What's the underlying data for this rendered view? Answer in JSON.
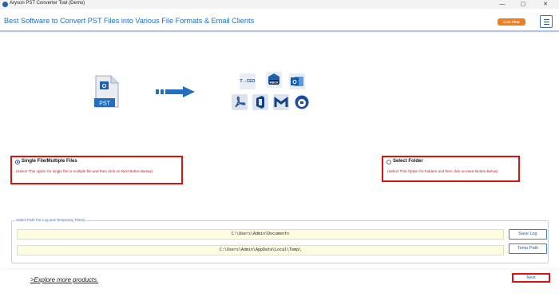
{
  "window": {
    "title": "Aryson PST Converter Tool (Demo)",
    "controls": {
      "minimize": "—",
      "maximize": "▢",
      "close": "✕"
    }
  },
  "header": {
    "title": "Best Software to Convert PST Files into Various File Formats & Email Clients",
    "live_chat": "Live Chat",
    "menu_icon": "hamburger-menu-icon"
  },
  "conversion_graphic": {
    "source_label": "PST",
    "targets": [
      {
        "name": "thunderbird-icon",
        "label": "T↔CEO"
      },
      {
        "name": "mbox-icon",
        "label": "MBOX"
      },
      {
        "name": "outlook-icon",
        "label": "O"
      },
      {
        "name": "pdf-icon",
        "label": ""
      },
      {
        "name": "office365-icon",
        "label": ""
      },
      {
        "name": "gmail-icon",
        "label": ""
      },
      {
        "name": "thunderbird-bird-icon",
        "label": ""
      }
    ]
  },
  "options": {
    "single": {
      "label": "Single File/Multiple Files",
      "description": "(Select This option for single file or multiple file and then click on Next Button Below)",
      "selected": true
    },
    "folder": {
      "label": "Select Folder",
      "description": "(Select This Option for Folders and then click on Next Button Below)",
      "selected": false
    }
  },
  "paths": {
    "legend": "Select Path For Log and Temporary File(s)",
    "log_path": "C:\\Users\\Admin\\Documents",
    "temp_path": "C:\\Users\\Admin\\AppData\\Local\\Temp\\",
    "save_log_label": "Save Log",
    "temp_path_label": "Temp Path"
  },
  "footer": {
    "explore": ">Explore more products.",
    "next": "Next"
  },
  "colors": {
    "accent": "#1f6fc2",
    "live_chat": "#f07e1c",
    "highlight": "#e01010",
    "path_bg": "#fefbe3"
  }
}
